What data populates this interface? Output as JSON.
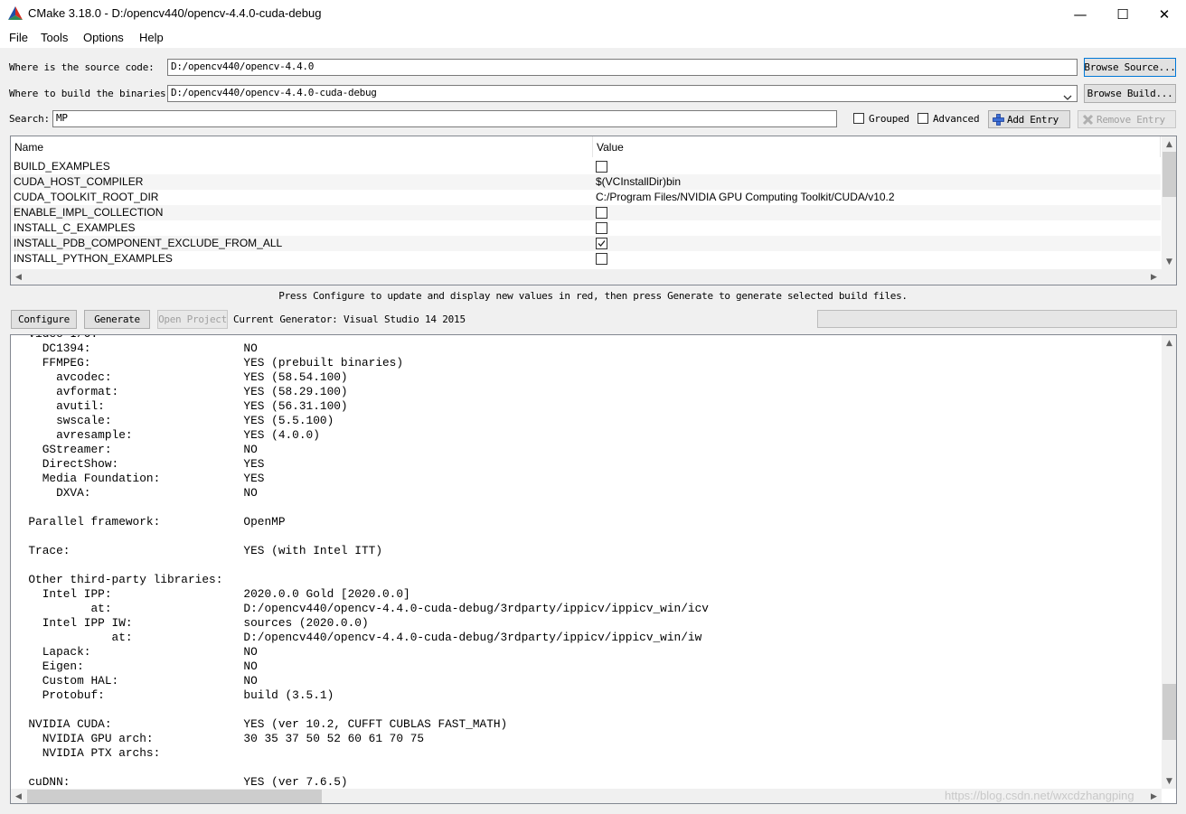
{
  "window": {
    "title": "CMake 3.18.0 - D:/opencv440/opencv-4.4.0-cuda-debug",
    "minimize_glyph": "—",
    "maximize_glyph": "☐",
    "close_glyph": "✕"
  },
  "menu": [
    "File",
    "Tools",
    "Options",
    "Help"
  ],
  "source": {
    "label": "Where is the source code:",
    "value": "D:/opencv440/opencv-4.4.0",
    "browse_label": "Browse Source..."
  },
  "binaries": {
    "label": "Where to build the binaries:",
    "value": "D:/opencv440/opencv-4.4.0-cuda-debug",
    "browse_label": "Browse Build..."
  },
  "search": {
    "label": "Search:",
    "value": "MP",
    "grouped_label": "Grouped",
    "grouped_checked": false,
    "advanced_label": "Advanced",
    "advanced_checked": false,
    "add_entry_label": "Add Entry",
    "remove_entry_label": "Remove Entry"
  },
  "table": {
    "headers": [
      "Name",
      "Value"
    ],
    "rows": [
      {
        "name": "BUILD_EXAMPLES",
        "type": "bool",
        "checked": false,
        "value": ""
      },
      {
        "name": "CUDA_HOST_COMPILER",
        "type": "text",
        "checked": false,
        "value": "$(VCInstallDir)bin"
      },
      {
        "name": "CUDA_TOOLKIT_ROOT_DIR",
        "type": "text",
        "checked": false,
        "value": "C:/Program Files/NVIDIA GPU Computing Toolkit/CUDA/v10.2"
      },
      {
        "name": "ENABLE_IMPL_COLLECTION",
        "type": "bool",
        "checked": false,
        "value": ""
      },
      {
        "name": "INSTALL_C_EXAMPLES",
        "type": "bool",
        "checked": false,
        "value": ""
      },
      {
        "name": "INSTALL_PDB_COMPONENT_EXCLUDE_FROM_ALL",
        "type": "bool",
        "checked": true,
        "value": ""
      },
      {
        "name": "INSTALL_PYTHON_EXAMPLES",
        "type": "bool",
        "checked": false,
        "value": ""
      }
    ]
  },
  "hint": "Press Configure to update and display new values in red, then press Generate to generate selected build files.",
  "actions": {
    "configure_label": "Configure",
    "generate_label": "Generate",
    "open_project_label": "Open Project",
    "generator_text": "Current Generator: Visual Studio 14 2015"
  },
  "output_lines": [
    "  Video I/O:",
    "    DC1394:                      NO",
    "    FFMPEG:                      YES (prebuilt binaries)",
    "      avcodec:                   YES (58.54.100)",
    "      avformat:                  YES (58.29.100)",
    "      avutil:                    YES (56.31.100)",
    "      swscale:                   YES (5.5.100)",
    "      avresample:                YES (4.0.0)",
    "    GStreamer:                   NO",
    "    DirectShow:                  YES",
    "    Media Foundation:            YES",
    "      DXVA:                      NO",
    "",
    "  Parallel framework:            OpenMP",
    "",
    "  Trace:                         YES (with Intel ITT)",
    "",
    "  Other third-party libraries:",
    "    Intel IPP:                   2020.0.0 Gold [2020.0.0]",
    "           at:                   D:/opencv440/opencv-4.4.0-cuda-debug/3rdparty/ippicv/ippicv_win/icv",
    "    Intel IPP IW:                sources (2020.0.0)",
    "              at:                D:/opencv440/opencv-4.4.0-cuda-debug/3rdparty/ippicv/ippicv_win/iw",
    "    Lapack:                      NO",
    "    Eigen:                       NO",
    "    Custom HAL:                  NO",
    "    Protobuf:                    build (3.5.1)",
    "",
    "  NVIDIA CUDA:                   YES (ver 10.2, CUFFT CUBLAS FAST_MATH)",
    "    NVIDIA GPU arch:             30 35 37 50 52 60 61 70 75",
    "    NVIDIA PTX archs:",
    "",
    "  cuDNN:                         YES (ver 7.6.5)"
  ],
  "watermark": "https://blog.csdn.net/wxcdzhangping",
  "colors": {
    "accent": "#0078d7",
    "window_bg": "#f0f0f0",
    "logo_red": "#d62d20",
    "logo_green": "#2e8b57",
    "logo_blue": "#1f4fa8"
  }
}
